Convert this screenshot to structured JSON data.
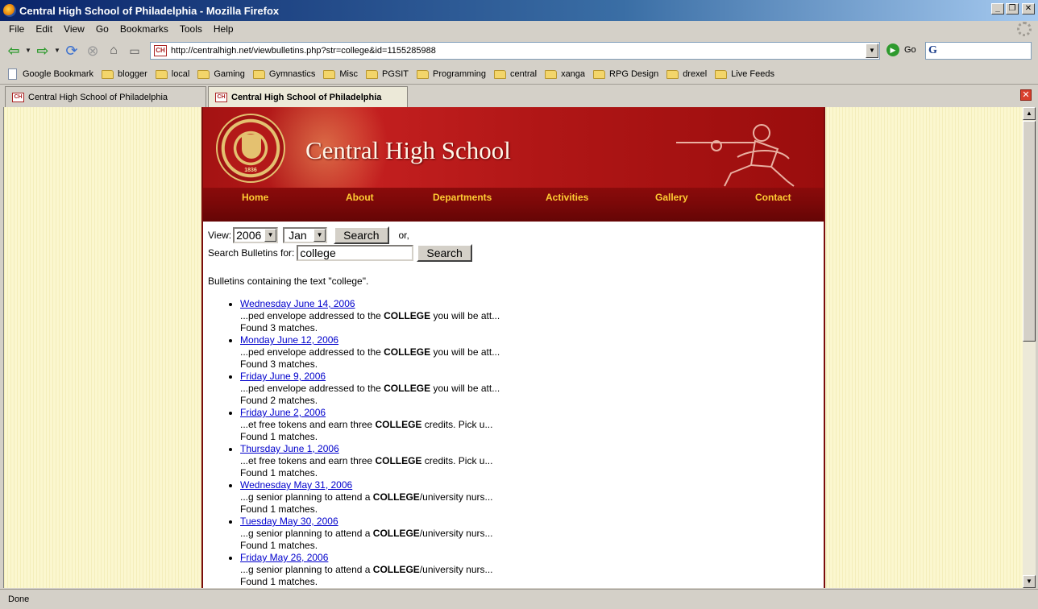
{
  "window": {
    "title": "Central High School of Philadelphia - Mozilla Firefox"
  },
  "menu": [
    "File",
    "Edit",
    "View",
    "Go",
    "Bookmarks",
    "Tools",
    "Help"
  ],
  "navbar": {
    "url": "http://centralhigh.net/viewbulletins.php?str=college&id=1155285988",
    "go_label": "Go",
    "search_value": ""
  },
  "bookmarks": [
    {
      "label": "Google Bookmark",
      "kind": "page"
    },
    {
      "label": "blogger",
      "kind": "folder"
    },
    {
      "label": "local",
      "kind": "folder"
    },
    {
      "label": "Gaming",
      "kind": "folder"
    },
    {
      "label": "Gymnastics",
      "kind": "folder"
    },
    {
      "label": "Misc",
      "kind": "folder"
    },
    {
      "label": "PGSIT",
      "kind": "folder"
    },
    {
      "label": "Programming",
      "kind": "folder"
    },
    {
      "label": "central",
      "kind": "folder"
    },
    {
      "label": "xanga",
      "kind": "folder"
    },
    {
      "label": "RPG Design",
      "kind": "folder"
    },
    {
      "label": "drexel",
      "kind": "folder"
    },
    {
      "label": "Live Feeds",
      "kind": "folder"
    }
  ],
  "tabs": [
    {
      "label": "Central High School of Philadelphia",
      "active": false
    },
    {
      "label": "Central High School of Philadelphia",
      "active": true
    }
  ],
  "site": {
    "title": "Central High School",
    "seal_year": "1836",
    "favicon_text": "CH",
    "nav": [
      "Home",
      "About",
      "Departments",
      "Activities",
      "Gallery",
      "Contact"
    ]
  },
  "form": {
    "view_label": "View:",
    "year": "2006",
    "month": "Jan",
    "search_label": "Search",
    "or_label": "or,",
    "search_bulletins_label": "Search Bulletins for:",
    "query": "college"
  },
  "results_heading": "Bulletins containing the text \"college\".",
  "results": [
    {
      "date": "Wednesday June 14, 2006",
      "pre": "...ped envelope addressed to the ",
      "kw": "COLLEGE",
      "post": " you will be att...",
      "matches": "Found 3 matches."
    },
    {
      "date": "Monday June 12, 2006",
      "pre": "...ped envelope addressed to the ",
      "kw": "COLLEGE",
      "post": " you will be att...",
      "matches": "Found 3 matches."
    },
    {
      "date": "Friday June 9, 2006",
      "pre": "...ped envelope addressed to the ",
      "kw": "COLLEGE",
      "post": " you will be att...",
      "matches": "Found 2 matches."
    },
    {
      "date": "Friday June 2, 2006",
      "pre": "...et free tokens and earn three ",
      "kw": "COLLEGE",
      "post": " credits. Pick u...",
      "matches": "Found 1 matches."
    },
    {
      "date": "Thursday June 1, 2006",
      "pre": "...et free tokens and earn three ",
      "kw": "COLLEGE",
      "post": " credits. Pick u...",
      "matches": "Found 1 matches."
    },
    {
      "date": "Wednesday May 31, 2006",
      "pre": "...g senior planning to attend a ",
      "kw": "COLLEGE",
      "post": "/university nurs...",
      "matches": "Found 1 matches."
    },
    {
      "date": "Tuesday May 30, 2006",
      "pre": "...g senior planning to attend a ",
      "kw": "COLLEGE",
      "post": "/university nurs...",
      "matches": "Found 1 matches."
    },
    {
      "date": "Friday May 26, 2006",
      "pre": "...g senior planning to attend a ",
      "kw": "COLLEGE",
      "post": "/university nurs...",
      "matches": "Found 1 matches."
    }
  ],
  "status": "Done",
  "colors": {
    "banner_red": "#b01616",
    "nav_strip": "#7a0808",
    "nav_link": "#ffcc33",
    "page_bg": "#fbf7cf",
    "link": "#0000cc"
  }
}
